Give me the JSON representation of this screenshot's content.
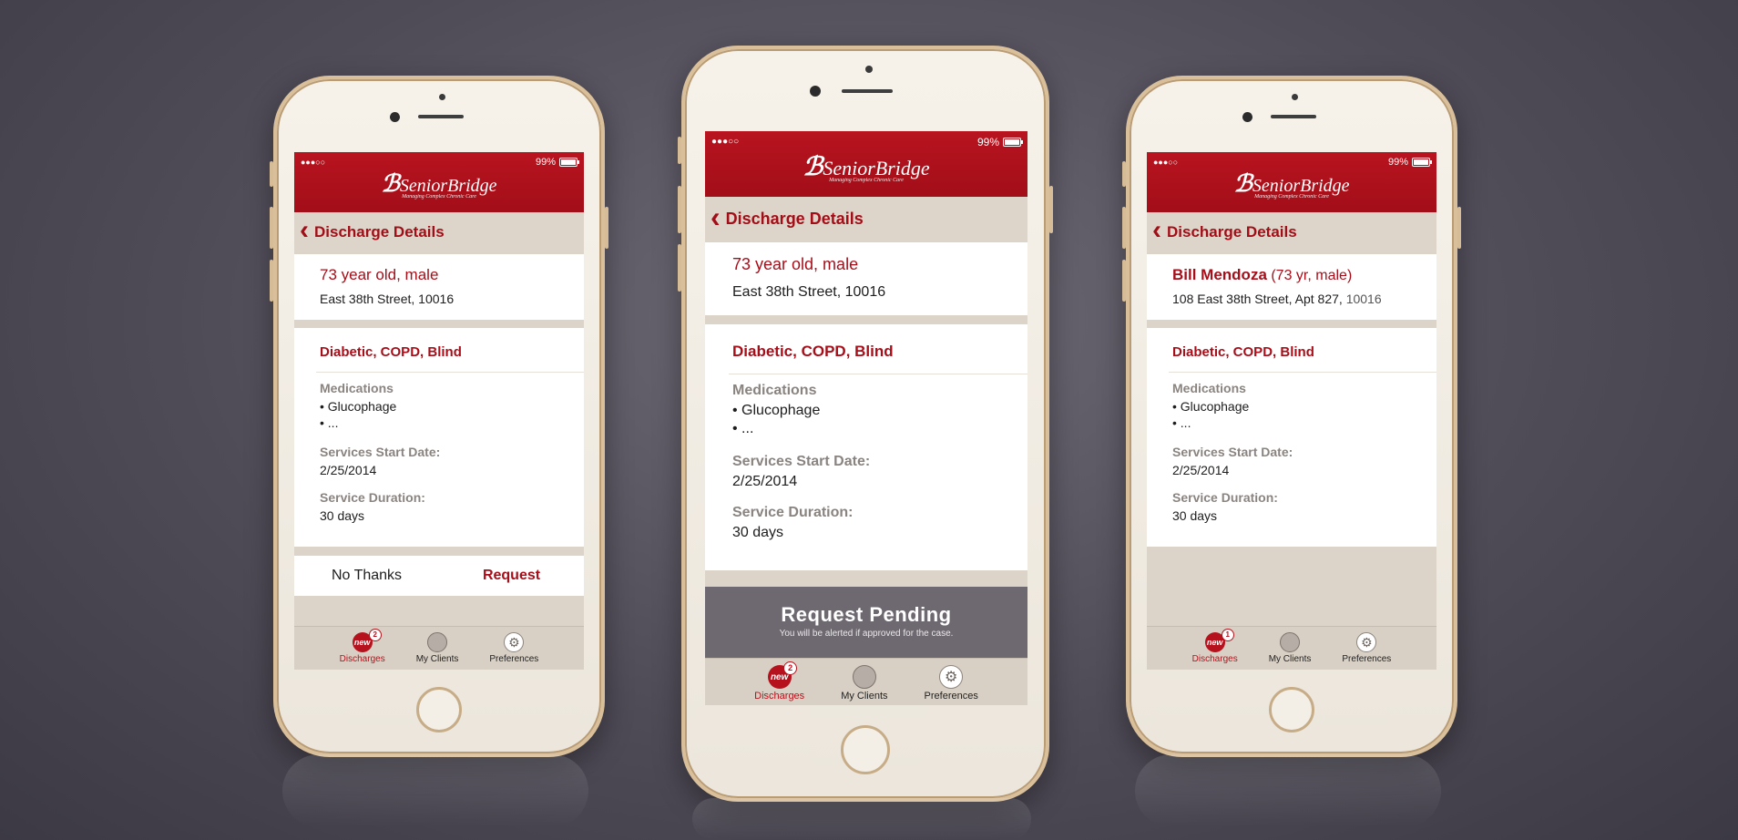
{
  "status": {
    "signal": "●●●○○",
    "battery": "99%"
  },
  "brand": {
    "name": "SeniorBridge",
    "tagline": "Managing Complex Chronic Care",
    "mark": "ℬ"
  },
  "nav": {
    "back_icon": "‹",
    "title": "Discharge Details"
  },
  "labels": {
    "medications": "Medications",
    "start_date": "Services Start Date:",
    "duration": "Service Duration:"
  },
  "phone_left": {
    "headline": "73 year old, male",
    "address": "East 38th Street, 10016",
    "conditions": "Diabetic, COPD, Blind",
    "med_1": "• Glucophage",
    "med_2": "• ...",
    "start_date": "2/25/2014",
    "duration": "30 days",
    "no_thanks": "No Thanks",
    "request": "Request"
  },
  "phone_center": {
    "headline": "73 year old, male",
    "address": "East 38th Street, 10016",
    "conditions": "Diabetic, COPD, Blind",
    "med_1": "• Glucophage",
    "med_2": "• ...",
    "start_date": "2/25/2014",
    "duration": "30 days",
    "pending_title": "Request Pending",
    "pending_sub": "You will be alerted if approved for the case."
  },
  "phone_right": {
    "name": "Bill Mendoza",
    "name_suffix": " (73 yr, male)",
    "address": "108 East 38th Street, Apt 827, ",
    "zip": "10016",
    "conditions": "Diabetic, COPD, Blind",
    "med_1": "• Glucophage",
    "med_2": "• ...",
    "start_date": "2/25/2014",
    "duration": "30 days"
  },
  "tabs": {
    "discharges": "Discharges",
    "clients": "My Clients",
    "preferences": "Preferences",
    "new_icon_text": "new",
    "gear_glyph": "⚙"
  },
  "badges": {
    "left": "2",
    "center": "2",
    "right": "1"
  },
  "colors": {
    "brand_red": "#a20e18",
    "pending_grey": "#6e6870"
  }
}
